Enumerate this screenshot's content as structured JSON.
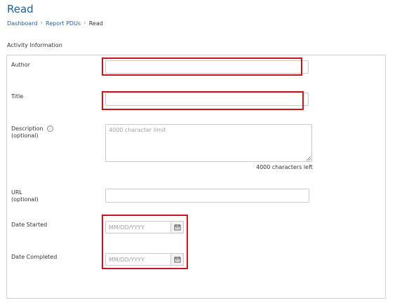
{
  "page": {
    "title": "Read"
  },
  "breadcrumb": {
    "items": [
      "Dashboard",
      "Report PDUs"
    ],
    "current": "Read"
  },
  "section": {
    "title": "Activity Information"
  },
  "form": {
    "author": {
      "label": "Author",
      "value": ""
    },
    "title": {
      "label": "Title",
      "value": ""
    },
    "description": {
      "label": "Description",
      "sublabel": "(optional)",
      "placeholder": "4000 character limit",
      "chars_left": "4000 characters left",
      "info_icon": "info-circle-icon"
    },
    "url": {
      "label": "URL",
      "sublabel": "(optional)",
      "value": ""
    },
    "date_started": {
      "label": "Date Started",
      "placeholder": "MM/DD/YYYY",
      "icon": "calendar-icon"
    },
    "date_completed": {
      "label": "Date Completed",
      "placeholder": "MM/DD/YYYY",
      "icon": "calendar-icon"
    }
  },
  "colors": {
    "accent": "#1f5f99",
    "highlight": "#c8161d",
    "border": "#c9c9c9"
  }
}
